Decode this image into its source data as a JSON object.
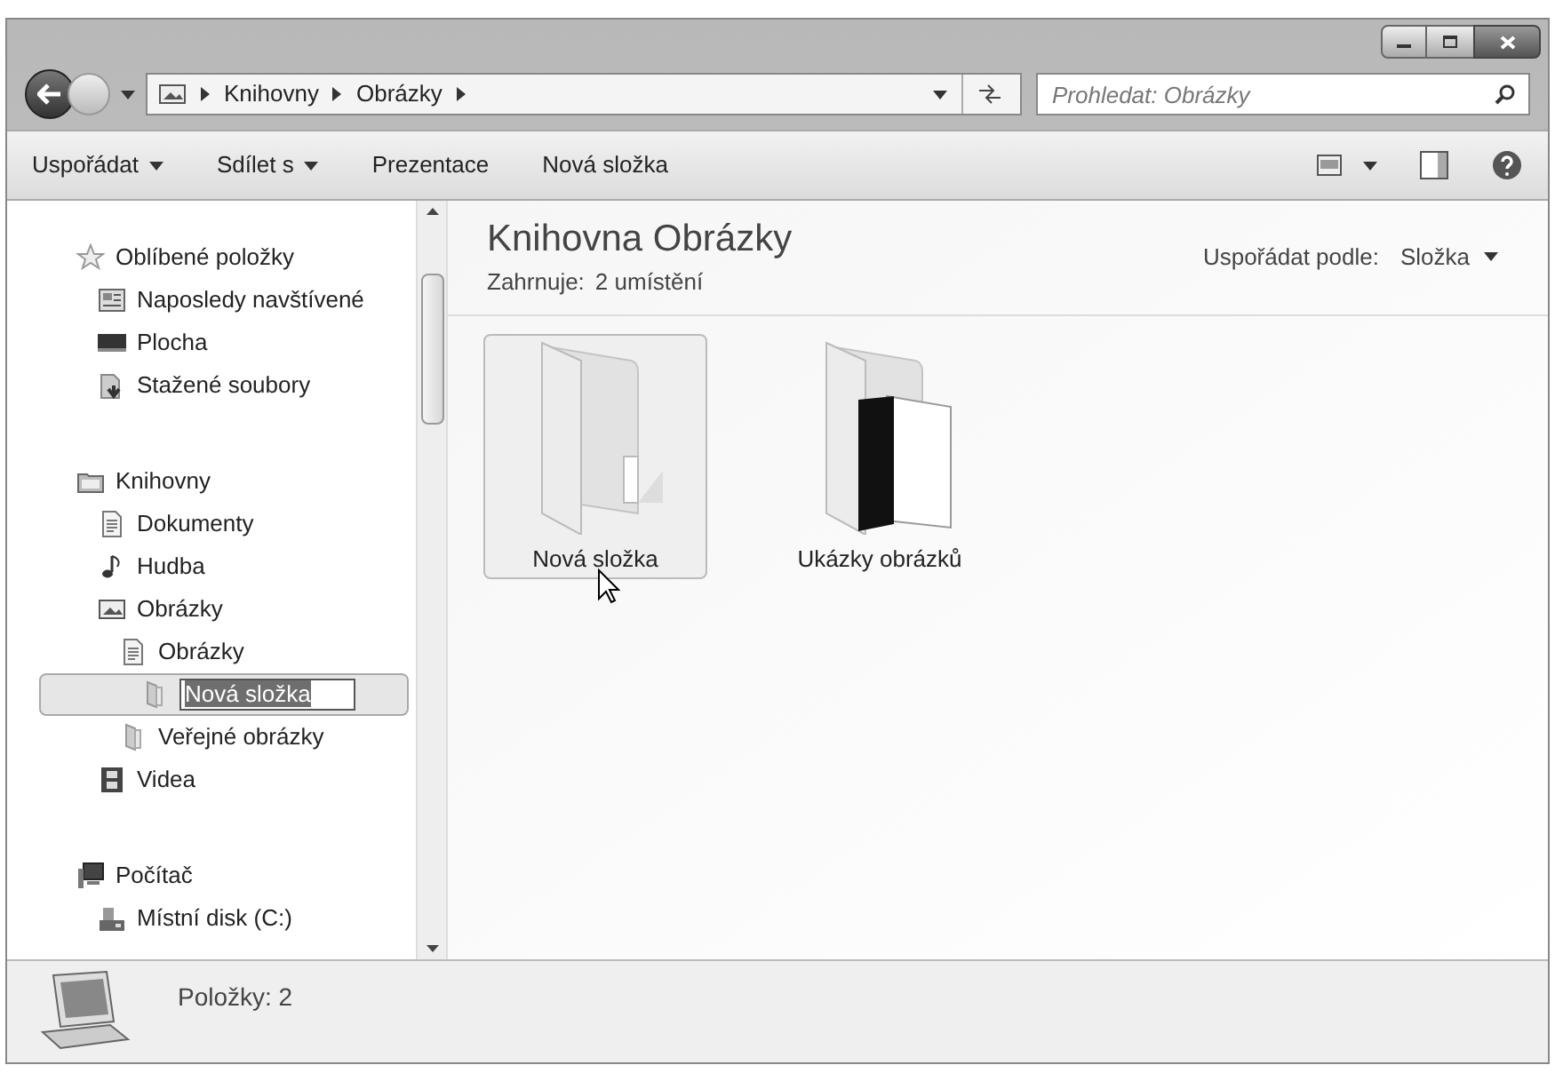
{
  "breadcrumb": [
    "Knihovny",
    "Obrázky"
  ],
  "search": {
    "placeholder": "Prohledat: Obrázky"
  },
  "toolbar": [
    {
      "label": "Uspořádat",
      "dropdown": true
    },
    {
      "label": "Sdílet s",
      "dropdown": true
    },
    {
      "label": "Prezentace",
      "dropdown": false
    },
    {
      "label": "Nová složka",
      "dropdown": false
    }
  ],
  "sidebar": [
    {
      "label": "Oblíbené položky",
      "kind": "star",
      "selected": false,
      "editing": false,
      "children": [
        {
          "label": "Naposledy navštívené",
          "kind": "recent",
          "selected": false,
          "editing": false
        },
        {
          "label": "Plocha",
          "kind": "desktop",
          "selected": false,
          "editing": false
        },
        {
          "label": "Stažené soubory",
          "kind": "download",
          "selected": false,
          "editing": false
        }
      ]
    },
    {
      "label": "Knihovny",
      "kind": "library",
      "selected": false,
      "editing": false,
      "children": [
        {
          "label": "Dokumenty",
          "kind": "document",
          "selected": false,
          "editing": false
        },
        {
          "label": "Hudba",
          "kind": "music",
          "selected": false,
          "editing": false
        },
        {
          "label": "Obrázky",
          "kind": "pictures",
          "selected": false,
          "editing": false,
          "children": [
            {
              "label": "Obrázky",
              "kind": "document",
              "selected": false,
              "editing": false,
              "children": [
                {
                  "label": "Nová složka",
                  "kind": "folder",
                  "selected": true,
                  "editing": true
                }
              ]
            },
            {
              "label": "Veřejné obrázky",
              "kind": "folder",
              "selected": false,
              "editing": false
            }
          ]
        },
        {
          "label": "Videa",
          "kind": "video",
          "selected": false,
          "editing": false
        }
      ]
    },
    {
      "label": "Počítač",
      "kind": "computer",
      "selected": false,
      "editing": false,
      "children": [
        {
          "label": "Místní disk (C:)",
          "kind": "disk",
          "selected": false,
          "editing": false
        }
      ]
    }
  ],
  "library": {
    "title": "Knihovna Obrázky",
    "includes_label": "Zahrnuje:",
    "includes_link": "2 umístění",
    "arrange_label": "Uspořádat podle:",
    "arrange_value": "Složka"
  },
  "files": [
    {
      "name": "Nová složka",
      "kind": "empty",
      "selected": true
    },
    {
      "name": "Ukázky obrázků",
      "kind": "pictures",
      "selected": false
    }
  ],
  "status_bar": {
    "text": "Položky: 2"
  }
}
